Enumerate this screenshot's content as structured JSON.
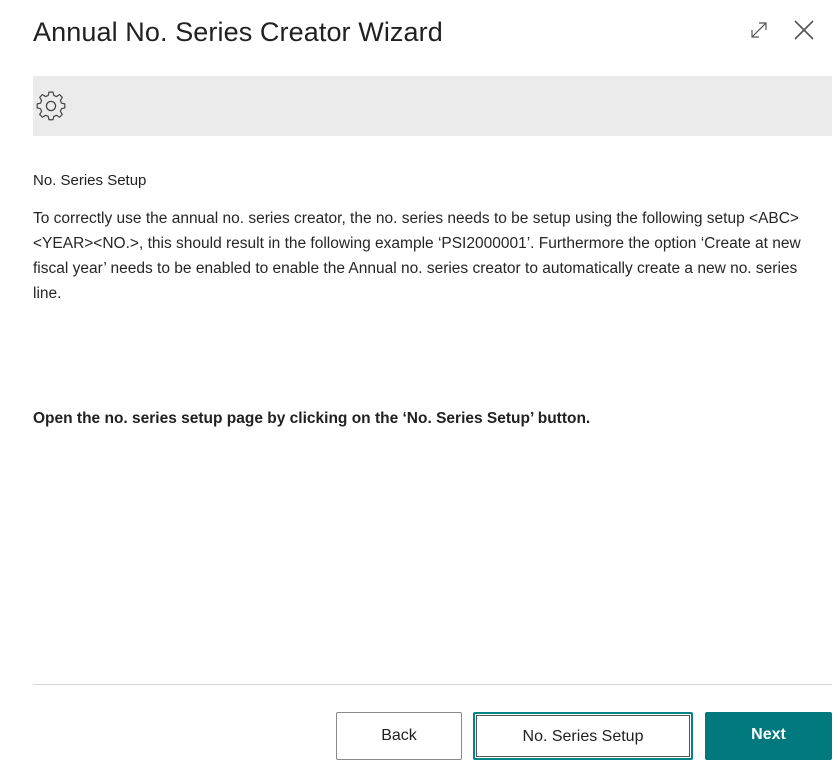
{
  "dialog": {
    "title": "Annual No. Series Creator Wizard"
  },
  "banner": {
    "icon": "gear-icon"
  },
  "content": {
    "heading": "No. Series Setup",
    "paragraph": "To correctly use the annual no. series creator, the no. series needs to be setup using the following setup <ABC><YEAR><NO.>, this should result in the following example ‘PSI2000001’. Furthermore the option ‘Create at new fiscal year’ needs to be enabled to enable the Annual no. series creator to automatically create a new no. series line.",
    "instruction": "Open the no. series setup page by clicking on the ‘No. Series Setup’ button."
  },
  "footer": {
    "back_label": "Back",
    "setup_label": "No. Series Setup",
    "next_label": "Next"
  },
  "colors": {
    "accent": "#00797e",
    "banner_bg": "#ebebeb",
    "text": "#212121"
  }
}
